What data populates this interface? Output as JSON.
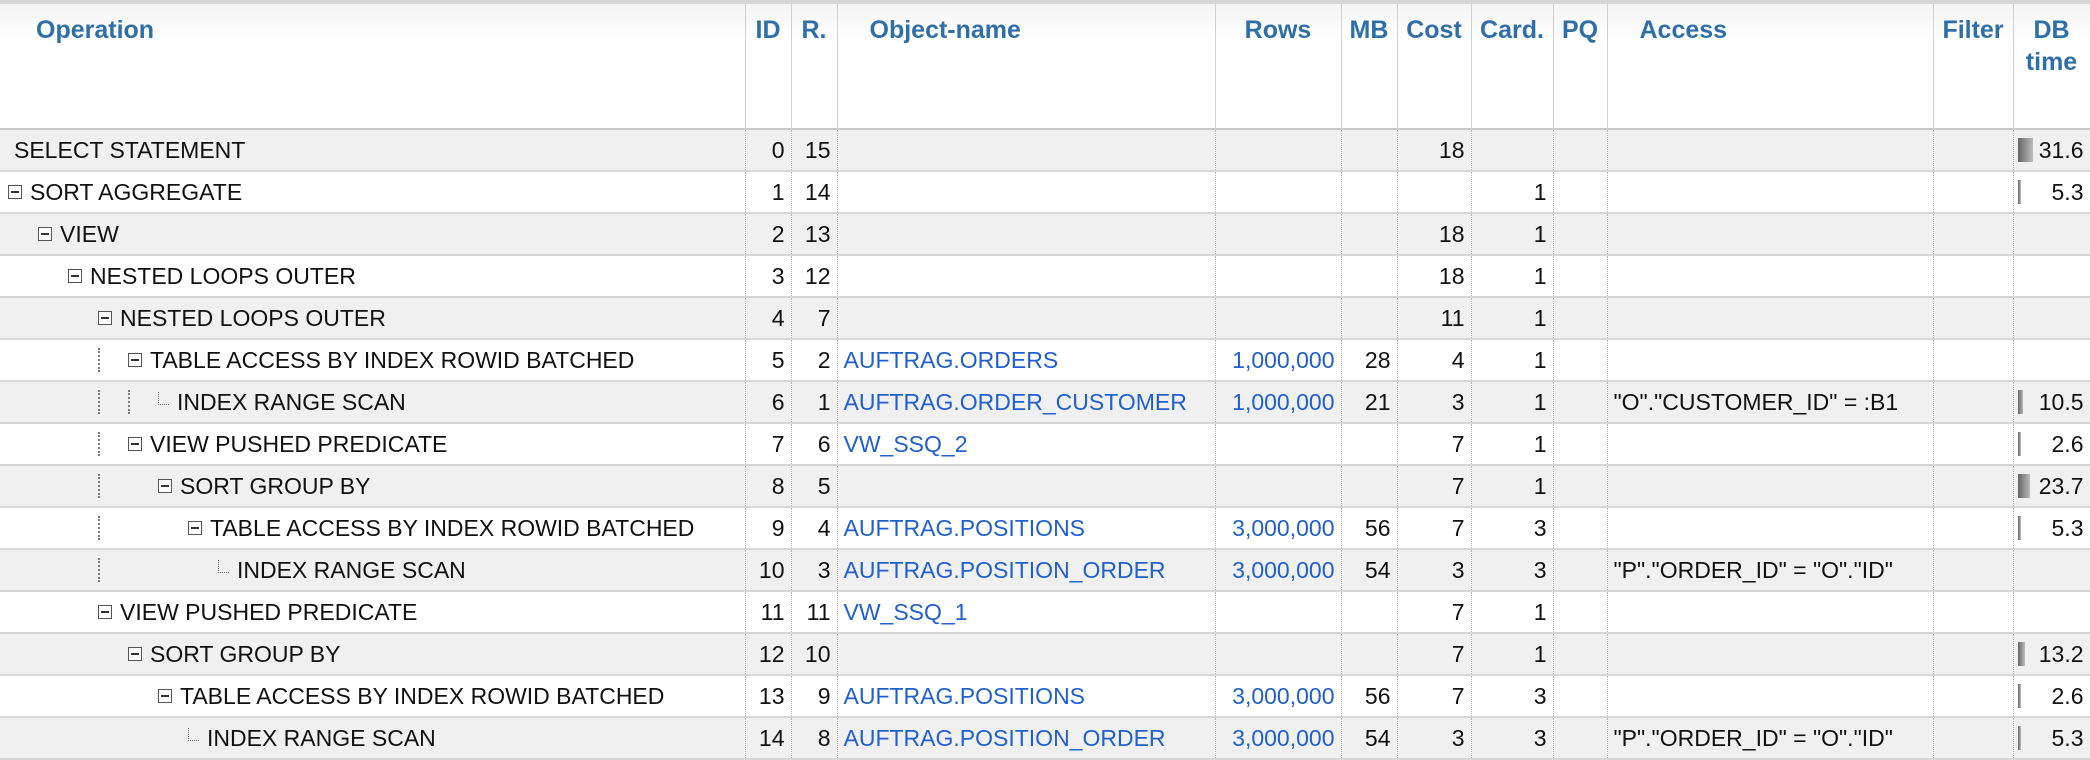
{
  "columns": [
    {
      "key": "op",
      "label": "Operation"
    },
    {
      "key": "id",
      "label": "ID"
    },
    {
      "key": "r",
      "label": "R."
    },
    {
      "key": "obj",
      "label": "Object-name"
    },
    {
      "key": "rows",
      "label": "Rows"
    },
    {
      "key": "mb",
      "label": "MB"
    },
    {
      "key": "cost",
      "label": "Cost"
    },
    {
      "key": "card",
      "label": "Card."
    },
    {
      "key": "pq",
      "label": "PQ"
    },
    {
      "key": "access",
      "label": "Access"
    },
    {
      "key": "filter",
      "label": "Filter"
    },
    {
      "key": "dbtime",
      "label": "DB time"
    }
  ],
  "rows": [
    {
      "op": "SELECT STATEMENT",
      "depth": 0,
      "toggle": false,
      "guides": 0,
      "elbow": false,
      "id": "0",
      "r": "15",
      "obj": "",
      "rows": "",
      "mb": "",
      "cost": "18",
      "card": "",
      "pq": "",
      "access": "",
      "filter": "",
      "dbtime": "31.6",
      "dbtime_fraction": 0.22
    },
    {
      "op": "SORT AGGREGATE",
      "depth": 0,
      "toggle": true,
      "guides": 0,
      "elbow": false,
      "id": "1",
      "r": "14",
      "obj": "",
      "rows": "",
      "mb": "",
      "cost": "",
      "card": "1",
      "pq": "",
      "access": "",
      "filter": "",
      "dbtime": "5.3",
      "dbtime_fraction": 0.04
    },
    {
      "op": "VIEW",
      "depth": 1,
      "toggle": true,
      "guides": 0,
      "elbow": false,
      "id": "2",
      "r": "13",
      "obj": "",
      "rows": "",
      "mb": "",
      "cost": "18",
      "card": "1",
      "pq": "",
      "access": "",
      "filter": "",
      "dbtime": "",
      "dbtime_fraction": 0
    },
    {
      "op": "NESTED LOOPS OUTER",
      "depth": 2,
      "toggle": true,
      "guides": 0,
      "elbow": false,
      "id": "3",
      "r": "12",
      "obj": "",
      "rows": "",
      "mb": "",
      "cost": "18",
      "card": "1",
      "pq": "",
      "access": "",
      "filter": "",
      "dbtime": "",
      "dbtime_fraction": 0
    },
    {
      "op": "NESTED LOOPS OUTER",
      "depth": 3,
      "toggle": true,
      "guides": 0,
      "elbow": false,
      "id": "4",
      "r": "7",
      "obj": "",
      "rows": "",
      "mb": "",
      "cost": "11",
      "card": "1",
      "pq": "",
      "access": "",
      "filter": "",
      "dbtime": "",
      "dbtime_fraction": 0
    },
    {
      "op": "TABLE ACCESS BY INDEX ROWID BATCHED",
      "depth": 4,
      "toggle": true,
      "guides": 1,
      "elbow": false,
      "id": "5",
      "r": "2",
      "obj": "AUFTRAG.ORDERS",
      "rows": "1,000,000",
      "mb": "28",
      "cost": "4",
      "card": "1",
      "pq": "",
      "access": "",
      "filter": "",
      "dbtime": "",
      "dbtime_fraction": 0
    },
    {
      "op": "INDEX RANGE SCAN",
      "depth": 5,
      "toggle": false,
      "guides": 2,
      "elbow": true,
      "id": "6",
      "r": "1",
      "obj": "AUFTRAG.ORDER_CUSTOMER",
      "rows": "1,000,000",
      "mb": "21",
      "cost": "3",
      "card": "1",
      "pq": "",
      "access": "\"O\".\"CUSTOMER_ID\" = :B1",
      "filter": "",
      "dbtime": "10.5",
      "dbtime_fraction": 0.08
    },
    {
      "op": "VIEW PUSHED PREDICATE",
      "depth": 4,
      "toggle": true,
      "guides": 1,
      "elbow": false,
      "id": "7",
      "r": "6",
      "obj": "VW_SSQ_2",
      "rows": "",
      "mb": "",
      "cost": "7",
      "card": "1",
      "pq": "",
      "access": "",
      "filter": "",
      "dbtime": "2.6",
      "dbtime_fraction": 0.02
    },
    {
      "op": "SORT GROUP BY",
      "depth": 5,
      "toggle": true,
      "guides": 1,
      "elbow": false,
      "id": "8",
      "r": "5",
      "obj": "",
      "rows": "",
      "mb": "",
      "cost": "7",
      "card": "1",
      "pq": "",
      "access": "",
      "filter": "",
      "dbtime": "23.7",
      "dbtime_fraction": 0.17
    },
    {
      "op": "TABLE ACCESS BY INDEX ROWID BATCHED",
      "depth": 6,
      "toggle": true,
      "guides": 1,
      "elbow": false,
      "id": "9",
      "r": "4",
      "obj": "AUFTRAG.POSITIONS",
      "rows": "3,000,000",
      "mb": "56",
      "cost": "7",
      "card": "3",
      "pq": "",
      "access": "",
      "filter": "",
      "dbtime": "5.3",
      "dbtime_fraction": 0.04
    },
    {
      "op": "INDEX RANGE SCAN",
      "depth": 7,
      "toggle": false,
      "guides": 1,
      "elbow": true,
      "id": "10",
      "r": "3",
      "obj": "AUFTRAG.POSITION_ORDER",
      "rows": "3,000,000",
      "mb": "54",
      "cost": "3",
      "card": "3",
      "pq": "",
      "access": "\"P\".\"ORDER_ID\" = \"O\".\"ID\"",
      "filter": "",
      "dbtime": "",
      "dbtime_fraction": 0
    },
    {
      "op": "VIEW PUSHED PREDICATE",
      "depth": 3,
      "toggle": true,
      "guides": 0,
      "elbow": false,
      "id": "11",
      "r": "11",
      "obj": "VW_SSQ_1",
      "rows": "",
      "mb": "",
      "cost": "7",
      "card": "1",
      "pq": "",
      "access": "",
      "filter": "",
      "dbtime": "",
      "dbtime_fraction": 0
    },
    {
      "op": "SORT GROUP BY",
      "depth": 4,
      "toggle": true,
      "guides": 0,
      "elbow": false,
      "id": "12",
      "r": "10",
      "obj": "",
      "rows": "",
      "mb": "",
      "cost": "7",
      "card": "1",
      "pq": "",
      "access": "",
      "filter": "",
      "dbtime": "13.2",
      "dbtime_fraction": 0.1
    },
    {
      "op": "TABLE ACCESS BY INDEX ROWID BATCHED",
      "depth": 5,
      "toggle": true,
      "guides": 0,
      "elbow": false,
      "id": "13",
      "r": "9",
      "obj": "AUFTRAG.POSITIONS",
      "rows": "3,000,000",
      "mb": "56",
      "cost": "7",
      "card": "3",
      "pq": "",
      "access": "",
      "filter": "",
      "dbtime": "2.6",
      "dbtime_fraction": 0.02
    },
    {
      "op": "INDEX RANGE SCAN",
      "depth": 6,
      "toggle": false,
      "guides": 0,
      "elbow": true,
      "id": "14",
      "r": "8",
      "obj": "AUFTRAG.POSITION_ORDER",
      "rows": "3,000,000",
      "mb": "54",
      "cost": "3",
      "card": "3",
      "pq": "",
      "access": "\"P\".\"ORDER_ID\" = \"O\".\"ID\"",
      "filter": "",
      "dbtime": "5.3",
      "dbtime_fraction": 0.04
    }
  ]
}
